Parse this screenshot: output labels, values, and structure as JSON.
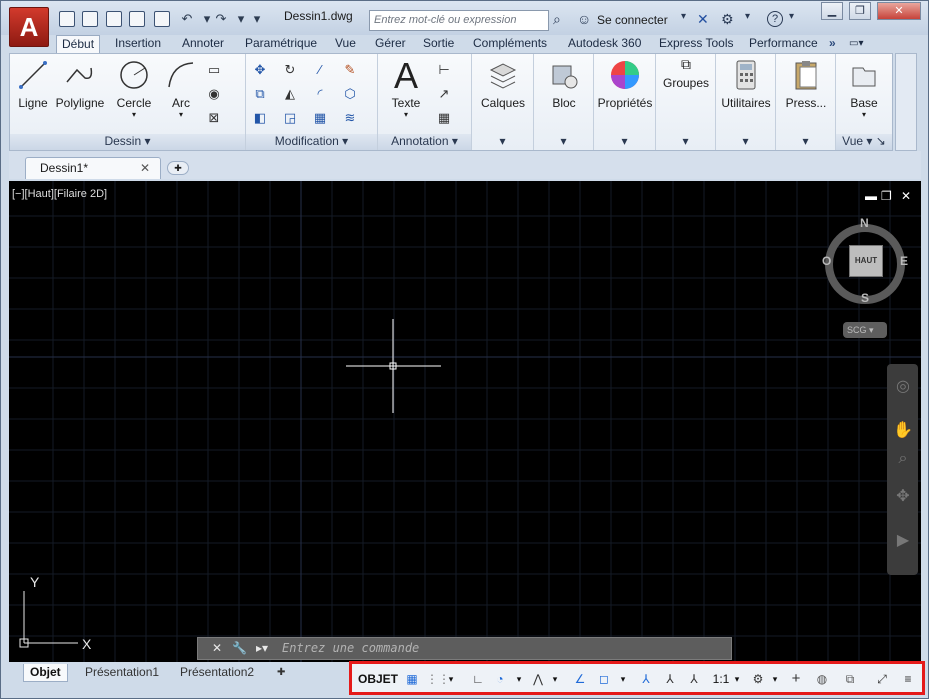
{
  "app": {
    "logo_letter": "A",
    "doc_title": "Dessin1.dwg"
  },
  "search": {
    "placeholder": "Entrez mot-clé ou expression"
  },
  "account": {
    "sign_in": "Se connecter"
  },
  "ribbon_tabs": [
    "Début",
    "Insertion",
    "Annoter",
    "Paramétrique",
    "Vue",
    "Gérer",
    "Sortie",
    "Compléments",
    "Autodesk 360",
    "Express Tools",
    "Performance"
  ],
  "panels": {
    "dessin": {
      "title": "Dessin",
      "tools": [
        "Ligne",
        "Polyligne",
        "Cercle",
        "Arc"
      ]
    },
    "modification": {
      "title": "Modification"
    },
    "annotation": {
      "title": "Annotation",
      "texte": "Texte"
    },
    "calques": "Calques",
    "bloc": "Bloc",
    "proprietes": "Propriétés",
    "groupes": "Groupes",
    "utilitaires": "Utilitaires",
    "presse": "Press...",
    "base": "Base",
    "vue": {
      "title": "Vue"
    }
  },
  "document_tabs": [
    {
      "label": "Dessin1*"
    }
  ],
  "viewport": {
    "label": "[−][Haut][Filaire 2D]"
  },
  "viewcube": {
    "face": "HAUT",
    "north": "N",
    "south": "S",
    "east": "E",
    "west": "O",
    "ucs_menu": "SCG"
  },
  "ucs": {
    "x": "X",
    "y": "Y"
  },
  "command_line": {
    "placeholder": "Entrez une commande"
  },
  "layout_tabs": [
    "Objet",
    "Présentation1",
    "Présentation2"
  ],
  "status_bar": {
    "model": "OBJET",
    "scale": "1:1"
  },
  "colors": {
    "canvas": "#000000",
    "grid": "#1c2333",
    "statusbar_highlight": "#e51a1a"
  }
}
